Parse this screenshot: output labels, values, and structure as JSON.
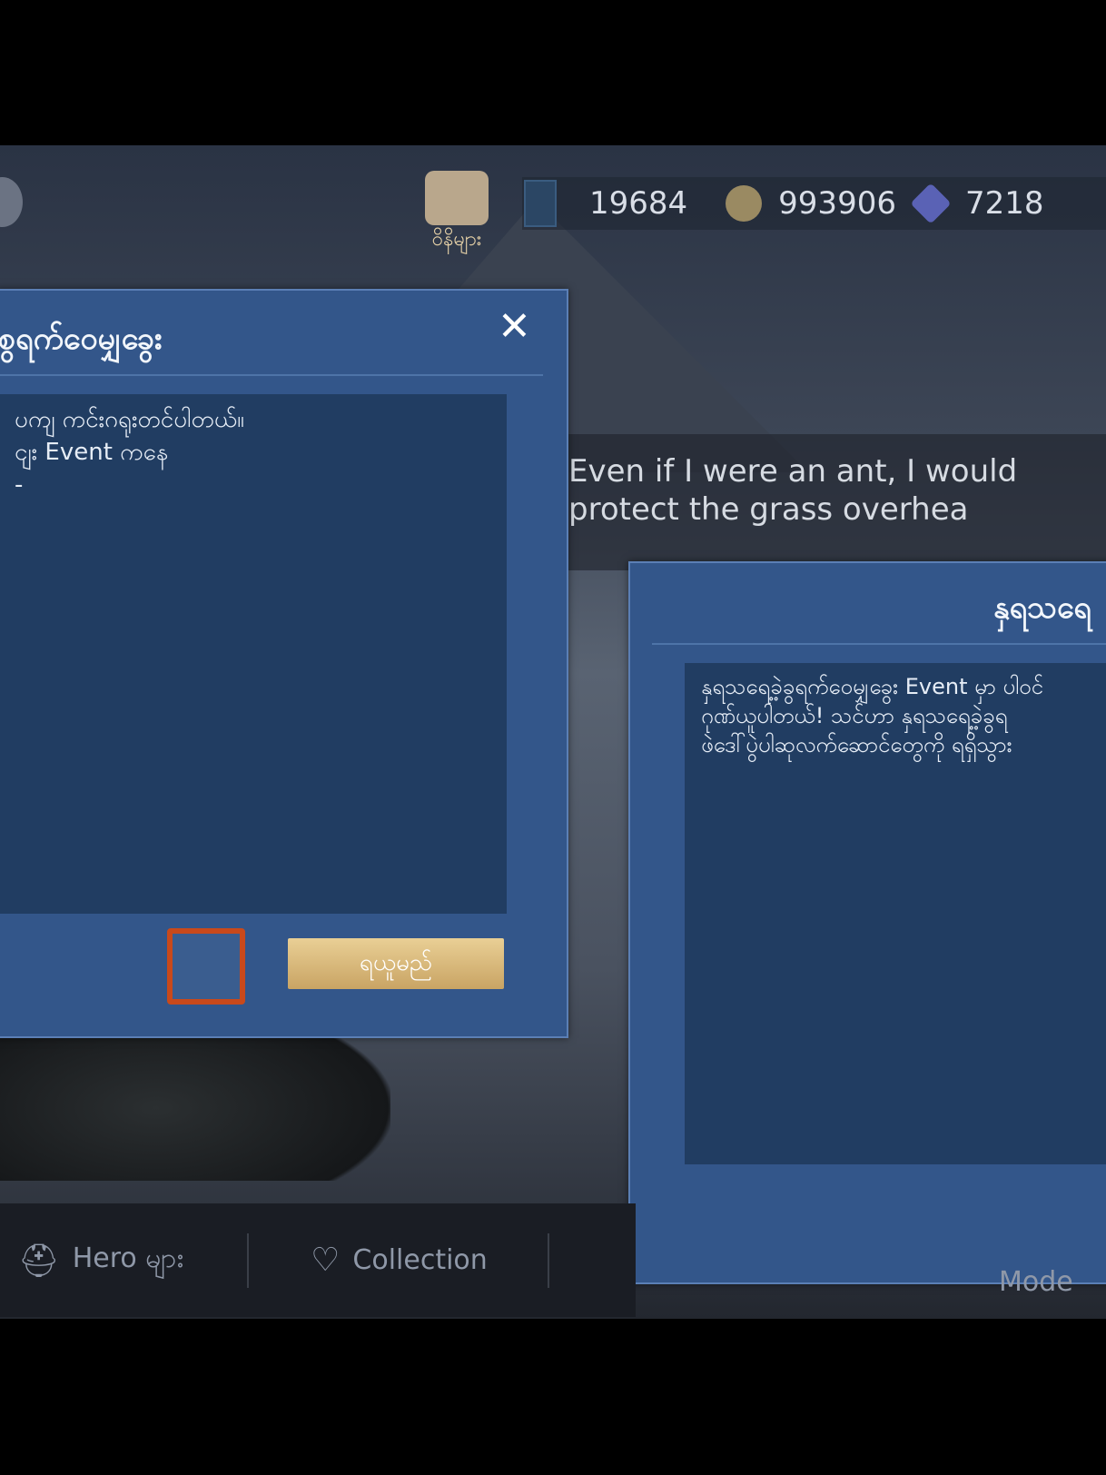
{
  "currency": {
    "tickets": "19684",
    "gold": "993906",
    "diamonds": "7218"
  },
  "shop_label": "ဝိနိများ",
  "quote": "Even if I were an ant, I would protect the grass overhea",
  "left_dialog": {
    "title": "စွရက်ဝေမျှခွေး",
    "body": [
      "ပကျ ကင်းဂရုးတင်ပါတယ်။",
      "ငျး Event ကနေ",
      "-"
    ],
    "claim_label": "ရယူမည်"
  },
  "right_dialog": {
    "title": "နှရသရေ",
    "body": [
      "နှရသရေ့ခဲ့ခွရက်ဝေမျှခွေး Event မှာ ပါဝင်",
      "ဂုဏ်ယူပါတယ်! သင်ဟာ နှရသရေ့ခဲ့ခွရ",
      "ဖဲဒေါ်ပွဲပါဆုလက်ဆောင်တွေကို ရရှိသွား"
    ]
  },
  "nav": {
    "heroes": "Hero များ",
    "collection": "Collection",
    "mode": "Mode"
  },
  "colors": {
    "dialog": "#33568a",
    "inner": "#213d62",
    "button": "#d9ba7c"
  }
}
